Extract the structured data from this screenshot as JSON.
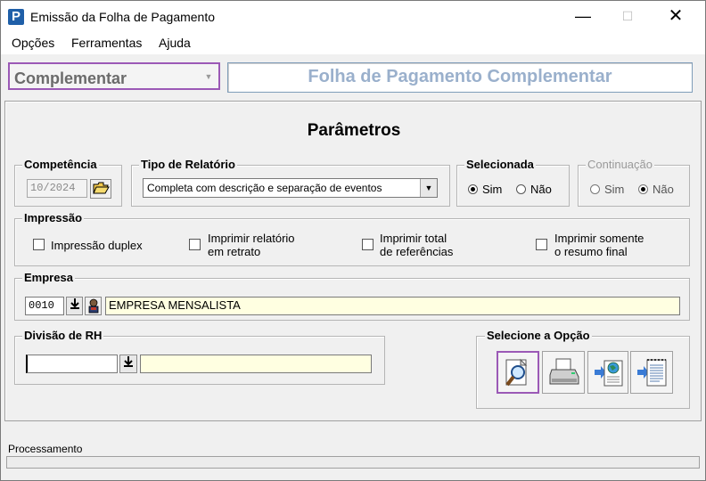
{
  "window": {
    "title": "Emissão da Folha de Pagamento",
    "icon_letter": "P"
  },
  "menu": {
    "items": [
      "Opções",
      "Ferramentas",
      "Ajuda"
    ]
  },
  "top": {
    "type_select_value": "Complementar",
    "header_title": "Folha de Pagamento Complementar"
  },
  "panel": {
    "title": "Parâmetros"
  },
  "competencia": {
    "label": "Competência",
    "value": "10/2024"
  },
  "tipo_relatorio": {
    "label": "Tipo de Relatório",
    "value": "Completa com descrição e separação de eventos"
  },
  "selecionada": {
    "label": "Selecionada",
    "sim": "Sim",
    "nao": "Não",
    "selected": "Sim"
  },
  "continuacao": {
    "label": "Continuação",
    "sim": "Sim",
    "nao": "Não",
    "selected": "Não"
  },
  "impressao": {
    "label": "Impressão",
    "options": [
      {
        "line1": "Impressão duplex",
        "line2": ""
      },
      {
        "line1": "Imprimir relatório",
        "line2": "em retrato"
      },
      {
        "line1": "Imprimir total",
        "line2": "de referências"
      },
      {
        "line1": "Imprimir somente",
        "line2": "o resumo final"
      }
    ]
  },
  "empresa": {
    "label": "Empresa",
    "code": "0010",
    "name": "EMPRESA MENSALISTA"
  },
  "divisao": {
    "label": "Divisão de RH",
    "code": "",
    "name": ""
  },
  "opcao": {
    "label": "Selecione a Opção"
  },
  "status": {
    "label": "Processamento"
  },
  "colors": {
    "accent": "#9b59b6",
    "header_text": "#9ab0cc",
    "highlight_field": "#ffffe1"
  }
}
